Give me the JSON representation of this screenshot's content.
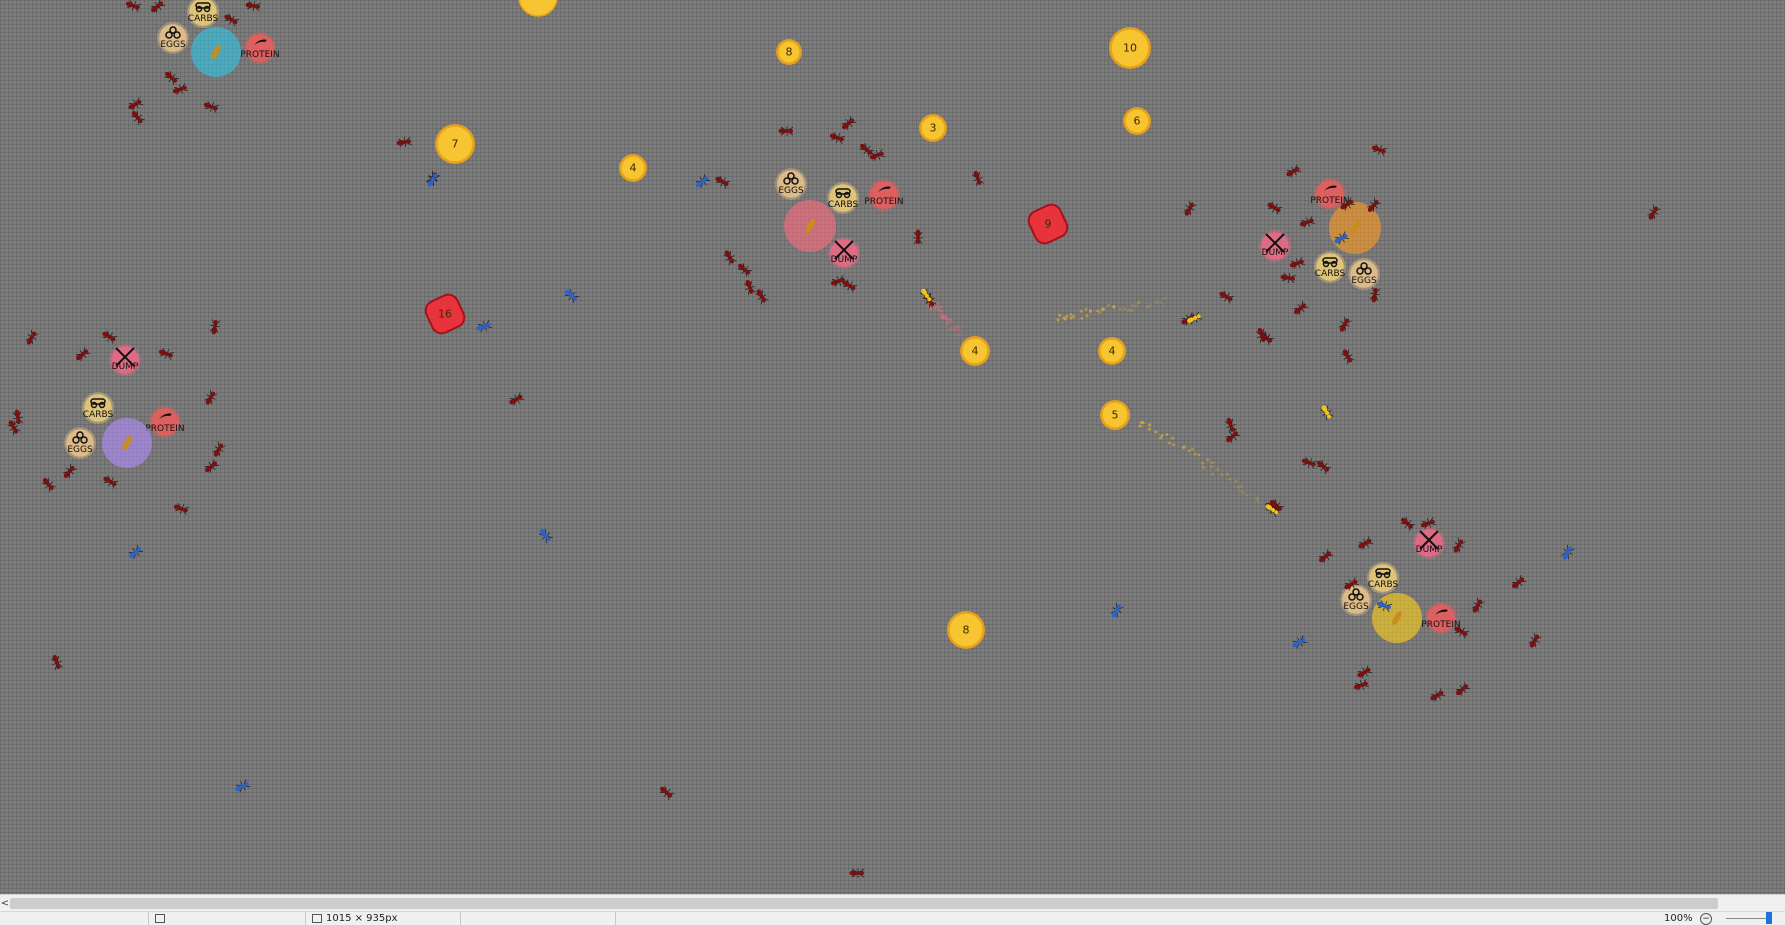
{
  "colonies": [
    {
      "name": "cyan",
      "queen": "#32c6e6",
      "zones": [
        {
          "type": "carbs",
          "label": "CARBS"
        },
        {
          "type": "eggs",
          "label": "EGGS"
        },
        {
          "type": "protein",
          "label": "PROTEIN"
        }
      ]
    },
    {
      "name": "pink",
      "queen": "#ff6b80",
      "zones": [
        {
          "type": "eggs",
          "label": "EGGS"
        },
        {
          "type": "carbs",
          "label": "CARBS"
        },
        {
          "type": "dump",
          "label": "DUMP"
        },
        {
          "type": "protein",
          "label": "PROTEIN"
        }
      ]
    },
    {
      "name": "orange",
      "queen": "#ff9a20",
      "zones": [
        {
          "type": "protein",
          "label": "PROTEIN"
        },
        {
          "type": "dump",
          "label": "DUMP"
        },
        {
          "type": "carbs",
          "label": "CARBS"
        },
        {
          "type": "eggs",
          "label": "EGGS"
        }
      ]
    },
    {
      "name": "purple",
      "queen": "#b48cff",
      "zones": [
        {
          "type": "dump",
          "label": "DUMP"
        },
        {
          "type": "carbs",
          "label": "CARBS"
        },
        {
          "type": "protein",
          "label": "PROTEIN"
        },
        {
          "type": "eggs",
          "label": "EGGS"
        }
      ]
    },
    {
      "name": "yellow",
      "queen": "#ffd21a",
      "zones": [
        {
          "type": "dump",
          "label": "DUMP"
        },
        {
          "type": "carbs",
          "label": "CARBS"
        },
        {
          "type": "eggs",
          "label": "EGGS"
        },
        {
          "type": "protein",
          "label": "PROTEIN"
        }
      ]
    }
  ],
  "food_sources": [
    {
      "kind": "sugar",
      "amount": "8"
    },
    {
      "kind": "sugar",
      "amount": "10"
    },
    {
      "kind": "sugar",
      "amount": "7"
    },
    {
      "kind": "sugar",
      "amount": "3"
    },
    {
      "kind": "sugar",
      "amount": "6"
    },
    {
      "kind": "sugar",
      "amount": "4"
    },
    {
      "kind": "meat",
      "amount": "9"
    },
    {
      "kind": "meat",
      "amount": "16"
    },
    {
      "kind": "sugar",
      "amount": "4"
    },
    {
      "kind": "sugar",
      "amount": "4"
    },
    {
      "kind": "sugar",
      "amount": "5"
    },
    {
      "kind": "sugar",
      "amount": "8"
    }
  ],
  "colors": {
    "sugar": "#f6c531",
    "sugar_ring": "#f9a51c",
    "meat": "#e8323c",
    "ant": "#7a1010",
    "scout": "#2b63c9",
    "zone_carbs": "#f4d37a",
    "zone_eggs": "#f2c98c",
    "zone_protein": "#f25c5c",
    "zone_dump": "#f06a86"
  },
  "statusbar": {
    "scroll_left_glyph": "<",
    "dimensions": "1015 × 935px",
    "zoom": "100%",
    "zoom_out": "−"
  }
}
